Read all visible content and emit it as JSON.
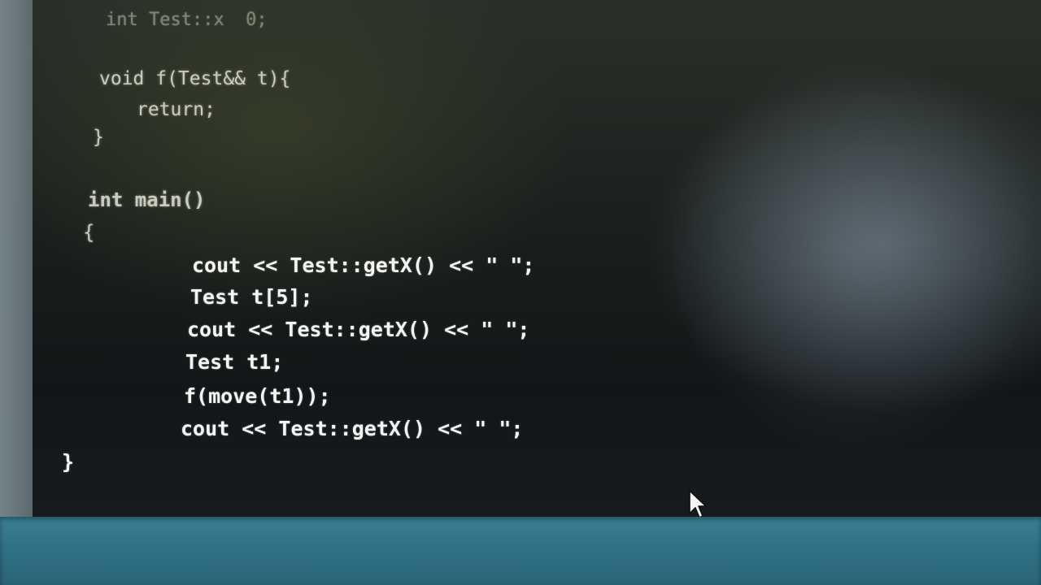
{
  "editor": {
    "lines": [
      "int Test::x  0;",
      "void f(Test&& t){",
      "return;",
      "}",
      "int main()",
      "{",
      "cout << Test::getX() << \" \";",
      "Test t[5];",
      "cout << Test::getX() << \" \";",
      "Test t1;",
      "f(move(t1));",
      "cout << Test::getX() << \" \";",
      "}"
    ]
  },
  "icons": {
    "pointer": "mouse-pointer-icon"
  },
  "colors": {
    "code_text": "#f4f4f2",
    "taskbar": "#2f7186"
  }
}
